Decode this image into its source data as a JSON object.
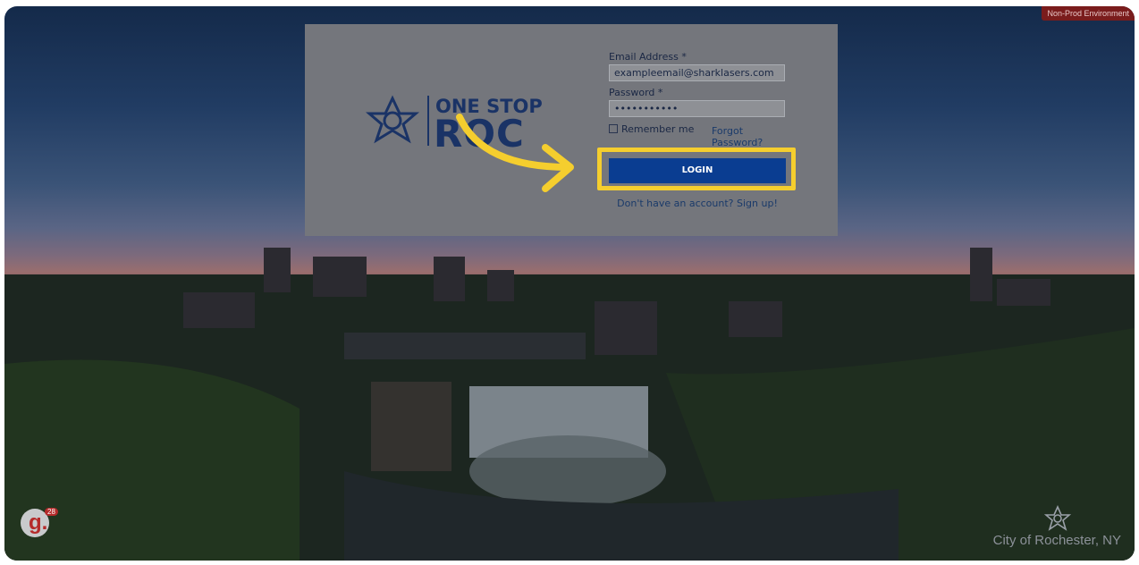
{
  "env_badge": "Non-Prod Environment",
  "logo": {
    "line1": "ONE STOP",
    "line2": "ROC"
  },
  "form": {
    "email_label": "Email Address *",
    "email_value": "exampleemail@sharklasers.com",
    "password_label": "Password *",
    "password_value": "•••••••••••",
    "remember_label": "Remember me",
    "forgot_label": "Forgot Password?",
    "login_label": "LOGIN",
    "signup_label": "Don't have an account? Sign up!"
  },
  "badge": {
    "letter": "g.",
    "count": "28"
  },
  "footer": {
    "city": "City of Rochester, NY"
  },
  "colors": {
    "brand": "#0a3d91",
    "highlight": "#f5ce2e",
    "env_badge": "#7a1c1c"
  },
  "icons": [
    "rochester-flower-logo-icon",
    "arrow-icon",
    "guidde-badge-icon"
  ]
}
